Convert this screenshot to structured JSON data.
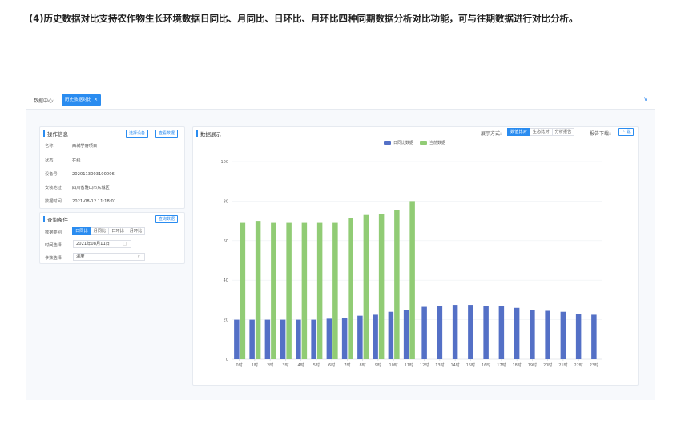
{
  "heading": "(4)历史数据对比支持农作物生长环境数据日同比、月同比、日环比、月环比四种同期数据分析对比功能，可与往期数据进行对比分析。",
  "topbar": {
    "crumb": "数据中心:",
    "active_tab": "历史数据对比",
    "close": "×",
    "expand_icon": "chevron-down"
  },
  "ops": {
    "title": "操作信息",
    "btn_select_device": "选择设备",
    "btn_view_data": "查看数据",
    "fields": [
      {
        "k": "名称:",
        "v": "西城学府项目"
      },
      {
        "k": "状态:",
        "v": "在线"
      },
      {
        "k": "设备号:",
        "v": "2020113003100006"
      },
      {
        "k": "安装地址:",
        "v": "四川省雅山市东城区"
      },
      {
        "k": "数据时间:",
        "v": "2021-08-12 11:18:01"
      }
    ]
  },
  "query": {
    "title": "查询条件",
    "btn_query": "查询数据",
    "type_label": "数据类别:",
    "types": [
      "日同比",
      "月同比",
      "日环比",
      "月环比"
    ],
    "time_label": "时间选择:",
    "time_value": "2021年08月11日",
    "param_label": "参数选择:",
    "param_value": "温度"
  },
  "display": {
    "title": "数据展示",
    "mode_label": "展示方式:",
    "modes": [
      "数值比对",
      "生态比对",
      "分析报告"
    ],
    "report_label": "报告下载:",
    "download": "下 载"
  },
  "chart_data": {
    "type": "bar",
    "categories": [
      "0时",
      "1时",
      "2时",
      "3时",
      "4时",
      "5时",
      "6时",
      "7时",
      "8时",
      "9时",
      "10时",
      "11时",
      "12时",
      "13时",
      "14时",
      "15时",
      "16时",
      "17时",
      "18时",
      "19时",
      "20时",
      "21时",
      "22时",
      "23时"
    ],
    "series": [
      {
        "name": "日同比数据",
        "color": "#5470c6",
        "values": [
          20,
          20,
          20,
          20,
          20,
          20,
          20.5,
          21,
          22,
          22.5,
          24,
          25,
          26.5,
          27,
          27.5,
          27.5,
          27,
          27,
          26,
          25,
          24.5,
          24,
          23,
          22.5
        ]
      },
      {
        "name": "当前数据",
        "color": "#91cc75",
        "values": [
          69,
          70,
          69,
          69,
          69,
          69,
          69,
          71.5,
          73,
          73.5,
          75.5,
          80,
          null,
          null,
          null,
          null,
          null,
          null,
          null,
          null,
          null,
          null,
          null,
          null
        ]
      }
    ],
    "yticks": [
      0,
      20,
      40,
      60,
      80,
      100
    ],
    "ylim": [
      0,
      100
    ]
  }
}
